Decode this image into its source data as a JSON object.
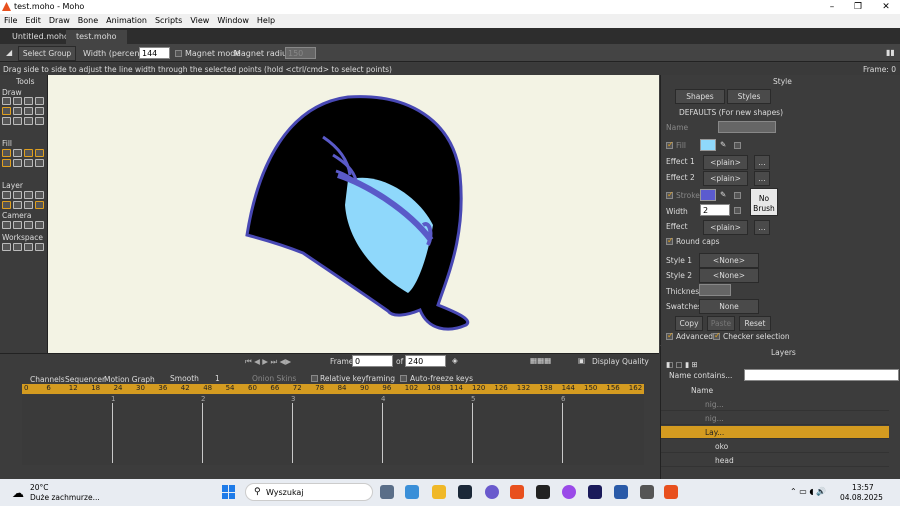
{
  "window": {
    "title": "test.moho - Moho",
    "minimize": "–",
    "maximize": "❐",
    "close": "✕"
  },
  "menu": [
    "File",
    "Edit",
    "Draw",
    "Bone",
    "Animation",
    "Scripts",
    "View",
    "Window",
    "Help"
  ],
  "tabs": [
    {
      "label": "Untitled.moho"
    },
    {
      "label": "test.moho"
    }
  ],
  "toolopts": {
    "select_group": "Select Group",
    "width_label": "Width (percent):",
    "width_value": "144",
    "magnet_mode": "Magnet mode",
    "magnet_radius": "Magnet radius",
    "magnet_radius_value": "150"
  },
  "hint": {
    "text": "Drag side to side to adjust the line width through the selected points (hold <ctrl/cmd> to select points)",
    "frame": "Frame: 0"
  },
  "tools": {
    "title": "Tools",
    "sections": [
      "Draw",
      "Fill",
      "Layer",
      "Camera",
      "Workspace"
    ]
  },
  "style": {
    "title": "Style",
    "shapes": "Shapes",
    "styles": "Styles",
    "defaults": "DEFAULTS (For new shapes)",
    "name": "Name",
    "fill": "Fill",
    "effect1": "Effect 1",
    "effect2": "Effect 2",
    "plain": "<plain>",
    "more": "...",
    "stroke": "Stroke",
    "width": "Width",
    "width_value": "2",
    "effect": "Effect",
    "no_brush": "No Brush",
    "round_caps": "Round caps",
    "style1": "Style 1",
    "style2": "Style 2",
    "none": "<None>",
    "thickness": "Thickness",
    "swatches": "Swatches",
    "swatches_value": "None",
    "copy": "Copy",
    "paste": "Paste",
    "reset": "Reset",
    "advanced": "Advanced",
    "checker": "Checker selection",
    "fill_color": "#8fd8fb",
    "stroke_color": "#5b5bcf"
  },
  "playback": {
    "frame_label": "Frame",
    "frame_value": "0",
    "of": "of",
    "total": "240",
    "display_quality": "Display Quality"
  },
  "timeline": {
    "tabs": [
      "Channels",
      "Sequencer",
      "Motion Graph"
    ],
    "smooth": "Smooth",
    "step": "1",
    "onion": "Onion Skins",
    "relative": "Relative keyframing",
    "autofreeze": "Auto-freeze keys",
    "ruler": [
      "0",
      "6",
      "12",
      "18",
      "24",
      "30",
      "36",
      "42",
      "48",
      "54",
      "60",
      "66",
      "72",
      "78",
      "84",
      "90",
      "96",
      "102",
      "108",
      "114",
      "120",
      "126",
      "132",
      "138",
      "144",
      "150",
      "156",
      "162"
    ],
    "seconds": [
      "1",
      "2",
      "3",
      "4",
      "5",
      "6"
    ]
  },
  "layers": {
    "title": "Layers",
    "filter": "Name contains...",
    "name_col": "Name",
    "rows": [
      {
        "name": "nig...",
        "dim": true
      },
      {
        "name": "nig...",
        "dim": true
      },
      {
        "name": "Lay...",
        "selected": true
      },
      {
        "name": "oko"
      },
      {
        "name": "head"
      }
    ]
  },
  "taskbar": {
    "weather_temp": "20°C",
    "weather_desc": "Duże zachmurze...",
    "search": "Wyszukaj",
    "time": "13:57",
    "date": "04.08.2025"
  }
}
